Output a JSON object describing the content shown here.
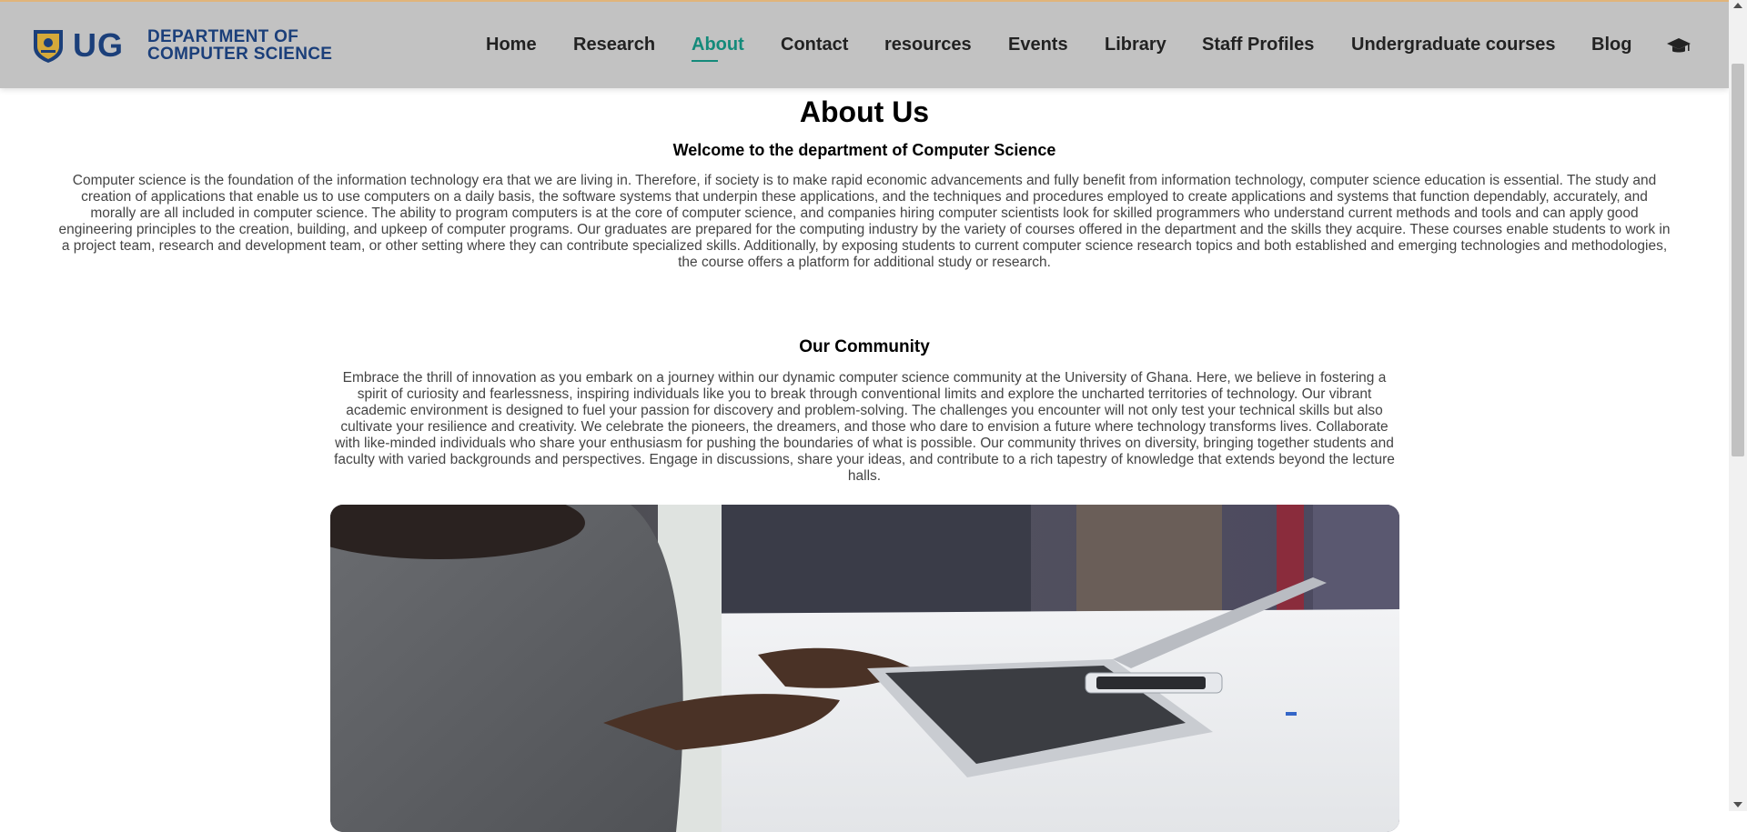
{
  "header": {
    "logo": {
      "abbrev": "UG",
      "line1": "DEPARTMENT OF",
      "line2": "COMPUTER SCIENCE"
    },
    "nav": [
      {
        "label": "Home",
        "active": false
      },
      {
        "label": "Research",
        "active": false
      },
      {
        "label": "About",
        "active": true
      },
      {
        "label": "Contact",
        "active": false
      },
      {
        "label": "resources",
        "active": false
      },
      {
        "label": "Events",
        "active": false
      },
      {
        "label": "Library",
        "active": false
      },
      {
        "label": "Staff Profiles",
        "active": false
      },
      {
        "label": "Undergraduate courses",
        "active": false
      },
      {
        "label": "Blog",
        "active": false
      }
    ],
    "icon": "graduation-cap-icon"
  },
  "about": {
    "title": "About Us",
    "subtitle": "Welcome to the department of Computer Science",
    "body": "Computer science is the foundation of the information technology era that we are living in. Therefore, if society is to make rapid economic advancements and fully benefit from information technology, computer science education is essential. The study and creation of applications that enable us to use computers on a daily basis, the software systems that underpin these applications, and the techniques and procedures employed to create applications and systems that function dependably, accurately, and morally are all included in computer science. The ability to program computers is at the core of computer science, and companies hiring computer scientists look for skilled programmers who understand current methods and tools and can apply good engineering principles to the creation, building, and upkeep of computer programs. Our graduates are prepared for the computing industry by the variety of courses offered in the department and the skills they acquire. These courses enable students to work in a project team, research and development team, or other setting where they can contribute specialized skills. Additionally, by exposing students to current computer science research topics and both established and emerging technologies and methodologies, the course offers a platform for additional study or research."
  },
  "community": {
    "title": "Our Community",
    "body": "Embrace the thrill of innovation as you embark on a journey within our dynamic computer science community at the University of Ghana. Here, we believe in fostering a spirit of curiosity and fearlessness, inspiring individuals like you to break through conventional limits and explore the uncharted territories of technology. Our vibrant academic environment is designed to fuel your passion for discovery and problem-solving. The challenges you encounter will not only test your technical skills but also cultivate your resilience and creativity. We celebrate the pioneers, the dreamers, and those who dare to envision a future where technology transforms lives. Collaborate with like-minded individuals who share your enthusiasm for pushing the boundaries of what is possible. Our community thrives on diversity, bringing together students and faculty with varied backgrounds and perspectives. Engage in discussions, share your ideas, and contribute to a rich tapestry of knowledge that extends beyond the lecture halls."
  },
  "colors": {
    "navbar_bg": "#c2c2c2",
    "brand_blue": "#1b3f7a",
    "active_link": "#148a7a",
    "body_text": "#444444"
  }
}
